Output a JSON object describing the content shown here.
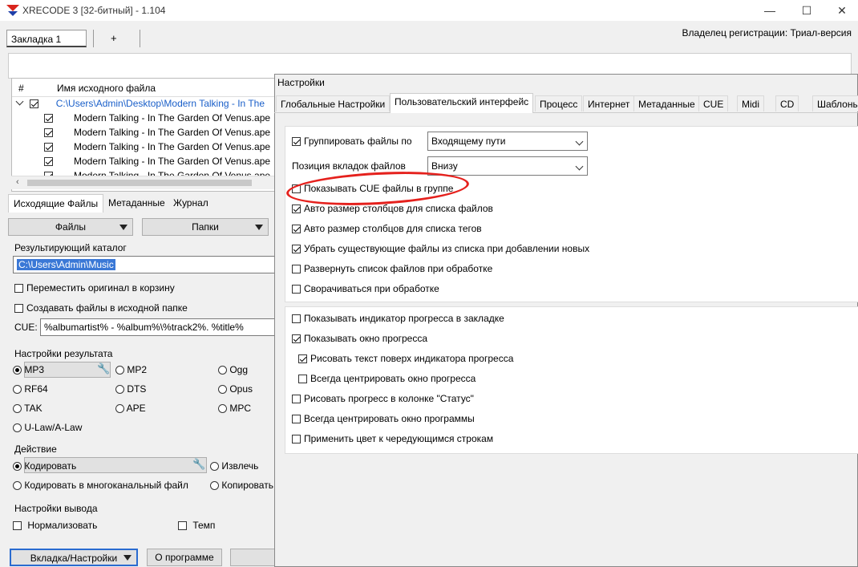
{
  "window": {
    "title": "XRECODE 3 [32-битный] - 1.104",
    "owner": "Владелец регистрации: Триал-версия",
    "minimize": "—",
    "maximize": "☐",
    "close": "✕"
  },
  "tabs": {
    "tab1": "Закладка 1",
    "add": "+"
  },
  "filelist": {
    "col_num": "#",
    "col_name": "Имя исходного файла",
    "folder": "C:\\Users\\Admin\\Desktop\\Modern Talking - In The",
    "files": [
      "Modern Talking - In The Garden Of Venus.ape",
      "Modern Talking - In The Garden Of Venus.ape",
      "Modern Talking - In The Garden Of Venus.ape",
      "Modern Talking - In The Garden Of Venus.ape",
      "Modern Talking - In The Garden Of Venus.ape"
    ]
  },
  "lowertabs": [
    "Исходящие Файлы",
    "Метаданные",
    "Журнал"
  ],
  "buttons": {
    "files": "Файлы",
    "folders": "Папки",
    "tab_settings": "Вкладка/Настройки",
    "about": "О программе"
  },
  "output": {
    "label": "Результирующий каталог",
    "path": "C:\\Users\\Admin\\Music",
    "move_to_trash": "Переместить оригинал в корзину",
    "create_in_source": "Создавать файлы в исходной папке",
    "cue_label": "CUE:",
    "cue_value": "%albumartist% - %album%\\%track2%. %title%"
  },
  "result_settings": {
    "label": "Настройки результата",
    "formats": [
      "MP3",
      "MP2",
      "Ogg",
      "RF64",
      "DTS",
      "Opus",
      "TAK",
      "APE",
      "MPC",
      "U-Law/A-Law"
    ]
  },
  "action": {
    "label": "Действие",
    "encode": "Кодировать",
    "extract": "Извлечь",
    "encode_multi": "Кодировать в многоканальный файл",
    "copy": "Копировать"
  },
  "output_settings": {
    "label": "Настройки вывода",
    "normalize": "Нормализовать",
    "tempo": "Темп"
  },
  "dialog": {
    "title": "Настройки",
    "tabs": [
      "Глобальные Настройки",
      "Пользовательский интерфейс",
      "Процесс",
      "Интернет",
      "Метаданные",
      "CUE",
      "Midi",
      "CD",
      "Шаблоны"
    ],
    "group_by_label": "Группировать файлы по",
    "group_by_value": "Входящему пути",
    "tab_position_label": "Позиция вкладок файлов",
    "tab_position_value": "Внизу",
    "opts1": [
      "Показывать CUE файлы в группе",
      "Авто размер столбцов для списка файлов",
      "Авто размер столбцов для списка тегов",
      "Убрать существующие файлы из списка при добавлении новых",
      "Развернуть список файлов при обработке",
      "Сворачиваться при обработке"
    ],
    "opts2": [
      "Показывать индикатор прогресса в закладке",
      "Показывать окно прогресса",
      "Рисовать текст поверх индикатора прогресса",
      "Всегда центрировать окно прогресса",
      "Рисовать прогресс в колонке \"Статус\"",
      "Всегда центрировать окно программы",
      "Применить цвет к чередующимся строкам"
    ]
  }
}
